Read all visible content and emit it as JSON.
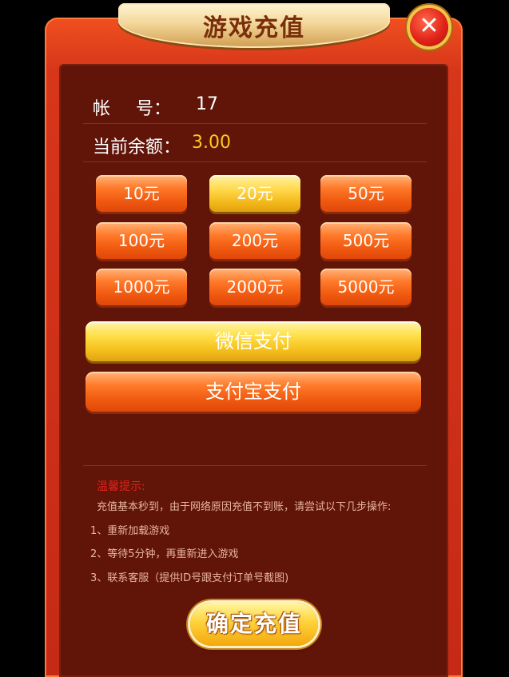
{
  "header": {
    "title": "游戏充值",
    "close_icon": "close-icon"
  },
  "account": {
    "label": "帐号：",
    "value": "17"
  },
  "balance": {
    "label": "当前余额：",
    "value": "3.00"
  },
  "amounts": [
    {
      "label": "10元",
      "selected": false
    },
    {
      "label": "20元",
      "selected": true
    },
    {
      "label": "50元",
      "selected": false
    },
    {
      "label": "100元",
      "selected": false
    },
    {
      "label": "200元",
      "selected": false
    },
    {
      "label": "500元",
      "selected": false
    },
    {
      "label": "1000元",
      "selected": false
    },
    {
      "label": "2000元",
      "selected": false
    },
    {
      "label": "5000元",
      "selected": false
    }
  ],
  "payments": {
    "wechat": "微信支付",
    "alipay": "支付宝支付"
  },
  "tips": {
    "title": "温馨提示:",
    "intro": "充值基本秒到，由于网络原因充值不到账，请尝试以下几步操作:",
    "steps": [
      "1、重新加载游戏",
      "2、等待5分钟，再重新进入游戏",
      "3、联系客服（提供ID号跟支付订单号截图)"
    ]
  },
  "confirm_label": "确定充值",
  "colors": {
    "accent_gold": "#ffc820",
    "panel_bg": "#611408",
    "tip_title": "#e2231a"
  }
}
